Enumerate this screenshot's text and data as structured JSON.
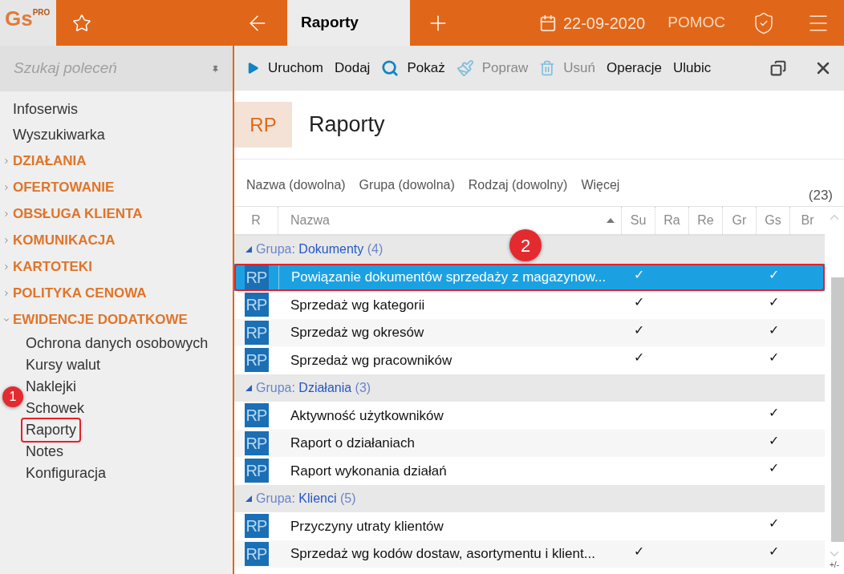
{
  "logo": {
    "text": "Gs",
    "badge": "PRO"
  },
  "top_bar": {
    "tab": {
      "label": "Raporty",
      "selected": true
    },
    "date": "22-09-2020",
    "help": "POMOC"
  },
  "sidebar": {
    "search": {
      "placeholder": "Szukaj poleceń"
    },
    "items": [
      {
        "kind": "link",
        "label": "Infoserwis"
      },
      {
        "kind": "link",
        "label": "Wyszukiwarka"
      },
      {
        "kind": "section",
        "label": "DZIAŁANIA",
        "expanded": false
      },
      {
        "kind": "section",
        "label": "OFERTOWANIE",
        "expanded": false
      },
      {
        "kind": "section",
        "label": "OBSŁUGA KLIENTA",
        "expanded": false
      },
      {
        "kind": "section",
        "label": "KOMUNIKACJA",
        "expanded": false
      },
      {
        "kind": "section",
        "label": "KARTOTEKI",
        "expanded": false
      },
      {
        "kind": "section",
        "label": "POLITYKA CENOWA",
        "expanded": false
      },
      {
        "kind": "section",
        "label": "EWIDENCJE DODATKOWE",
        "expanded": true,
        "children": [
          {
            "label": "Ochrona danych osobowych",
            "annotated": false
          },
          {
            "label": "Kursy walut",
            "annotated": false
          },
          {
            "label": "Naklejki",
            "annotated": false
          },
          {
            "label": "Schowek",
            "annotated": false
          },
          {
            "label": "Raporty",
            "annotated": true
          },
          {
            "label": "Notes",
            "annotated": false
          },
          {
            "label": "Konfiguracja",
            "annotated": false
          }
        ]
      }
    ]
  },
  "toolbar": [
    {
      "label": "Uruchom",
      "kind": "run",
      "disabled": false
    },
    {
      "label": "Dodaj",
      "kind": "plain",
      "disabled": false
    },
    {
      "label": "Pokaż",
      "kind": "show",
      "disabled": false
    },
    {
      "label": "Popraw",
      "kind": "edit",
      "disabled": true
    },
    {
      "label": "Usuń",
      "kind": "delete",
      "disabled": true
    },
    {
      "label": "Operacje",
      "kind": "plain",
      "disabled": false
    },
    {
      "label": "Ulubic",
      "kind": "plain",
      "disabled": false
    }
  ],
  "header": {
    "badge": "RP",
    "title": "Raporty"
  },
  "filters": [
    "Nazwa (dowolna)",
    "Grupa (dowolna)",
    "Rodzaj (dowolny)",
    "Więcej"
  ],
  "count": "(23)",
  "table": {
    "columns": [
      {
        "label": "R",
        "sorted": false
      },
      {
        "label": "Nazwa",
        "sorted": true
      },
      {
        "label": "Su",
        "sorted": false
      },
      {
        "label": "Ra",
        "sorted": false
      },
      {
        "label": "Re",
        "sorted": false
      },
      {
        "label": "Gr",
        "sorted": false
      },
      {
        "label": "Gs",
        "sorted": false
      },
      {
        "label": "Br",
        "sorted": false
      }
    ],
    "rows": [
      {
        "kind": "group",
        "label": "Grupa: **Dokumenty** (4)",
        "expanded": true
      },
      {
        "kind": "item",
        "badge": "RP",
        "name": "Powiązanie dokumentów sprzedaży z magazynow...",
        "su": "✓",
        "gs": "✓",
        "selected": true,
        "annotated": true
      },
      {
        "kind": "item",
        "badge": "RP",
        "name": "Sprzedaż wg kategorii",
        "su": "✓",
        "gs": "✓",
        "selected": false,
        "annotated": false
      },
      {
        "kind": "item",
        "badge": "RP",
        "name": "Sprzedaż wg okresów",
        "su": "✓",
        "gs": "✓",
        "selected": false,
        "annotated": false
      },
      {
        "kind": "item",
        "badge": "RP",
        "name": "Sprzedaż wg pracowników",
        "su": "✓",
        "gs": "✓",
        "selected": false,
        "annotated": false
      },
      {
        "kind": "group",
        "label": "Grupa: **Działania** (3)",
        "expanded": true
      },
      {
        "kind": "item",
        "badge": "RP",
        "name": "Aktywność użytkowników",
        "gs": "✓",
        "selected": false,
        "annotated": false
      },
      {
        "kind": "item",
        "badge": "RP",
        "name": "Raport o działaniach",
        "gs": "✓",
        "selected": false,
        "annotated": false
      },
      {
        "kind": "item",
        "badge": "RP",
        "name": "Raport wykonania działań",
        "gs": "✓",
        "selected": false,
        "annotated": false
      },
      {
        "kind": "group",
        "label": "Grupa: **Klienci** (5)",
        "expanded": true
      },
      {
        "kind": "item",
        "badge": "RP",
        "name": "Przyczyny utraty klientów",
        "gs": "✓",
        "selected": false,
        "annotated": false
      },
      {
        "kind": "item",
        "badge": "RP",
        "name": "Sprzedaż wg kodów dostaw, asortymentu i klient...",
        "su": "✓",
        "gs": "✓",
        "selected": false,
        "annotated": false
      }
    ]
  },
  "resize_hint": "+/-",
  "annotations": [
    {
      "label": "1"
    },
    {
      "label": "2"
    }
  ]
}
